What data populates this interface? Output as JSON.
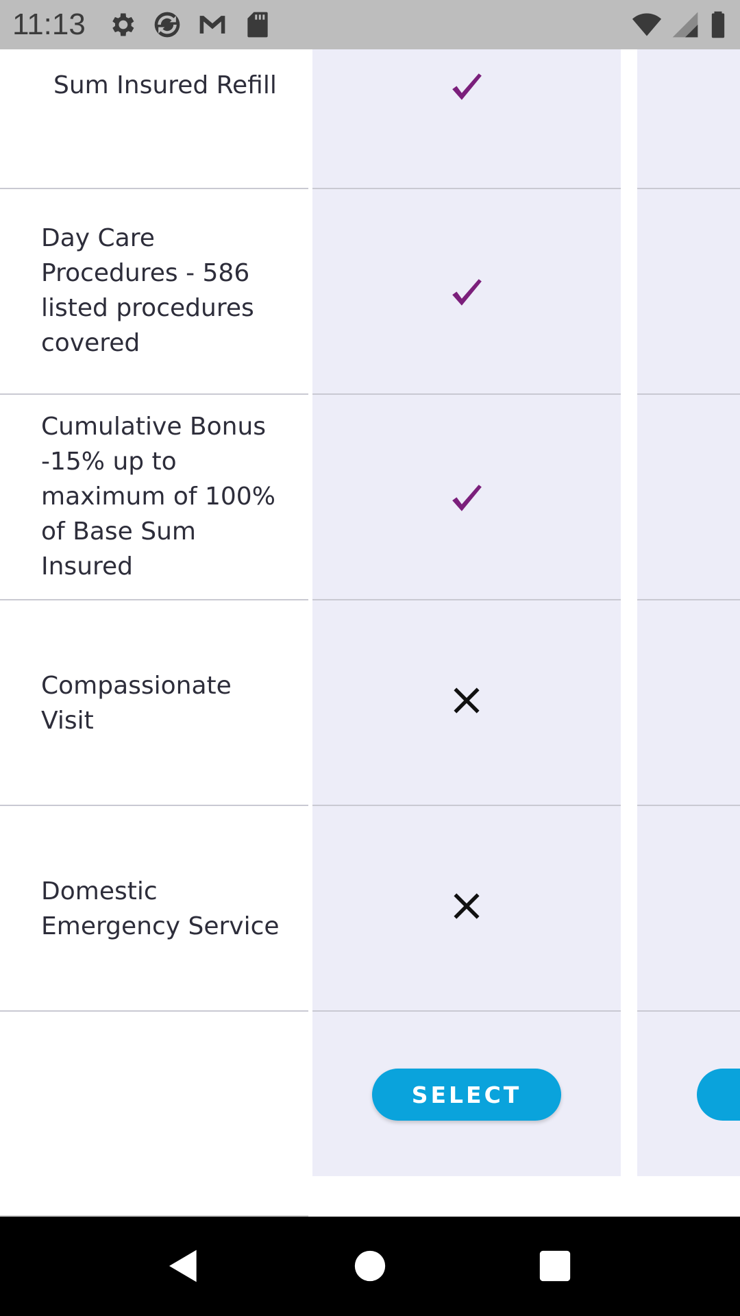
{
  "status_bar": {
    "time": "11:13",
    "left_icons": [
      "gear-icon",
      "sync-icon",
      "gmail-icon",
      "sd-card-icon"
    ],
    "right_icons": [
      "wifi-icon",
      "signal-icon",
      "battery-icon"
    ]
  },
  "features": [
    {
      "label": "Sum Insured Refill",
      "plan_a": "check"
    },
    {
      "label": "Day Care Procedures - 586 listed procedures covered",
      "plan_a": "check"
    },
    {
      "label": "Cumulative Bonus -15% up to maximum of 100% of  Base Sum Insured",
      "plan_a": "check"
    },
    {
      "label": "Compassionate Visit",
      "plan_a": "cross"
    },
    {
      "label": "Domestic Emergency Service",
      "plan_a": "cross"
    }
  ],
  "select_label": "SELECT",
  "colors": {
    "check": "#7b1f7b",
    "cross": "#111111",
    "plan_column_bg": "#ededf8",
    "button": "#0aa3dc",
    "status_bar_bg": "#bdbdbd"
  },
  "nav_bar": {
    "buttons": [
      "back-icon",
      "home-icon",
      "recents-icon"
    ]
  }
}
